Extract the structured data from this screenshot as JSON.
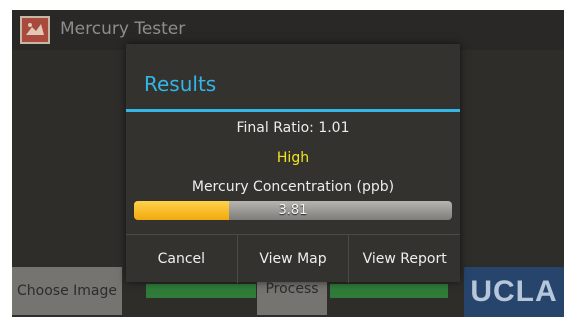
{
  "app": {
    "title": "Mercury Tester",
    "icon": "mercury-tester-app-icon"
  },
  "background": {
    "choose_image_label": "Choose Image",
    "process_label": "Process",
    "logo_text": "UCLA"
  },
  "dialog": {
    "title": "Results",
    "final_ratio_text": "Final Ratio: 1.01",
    "level_text": "High",
    "concentration_label": "Mercury Concentration (ppb)",
    "concentration_value": "3.81",
    "progress_fraction": 0.3,
    "buttons": {
      "cancel": "Cancel",
      "view_map": "View Map",
      "view_report": "View Report"
    }
  },
  "colors": {
    "accent": "#33b5e5",
    "level_high": "#f1e61c",
    "progress_fill": "#f2a90d",
    "status_green": "#2f7c3a",
    "logo_background": "#27456c"
  }
}
